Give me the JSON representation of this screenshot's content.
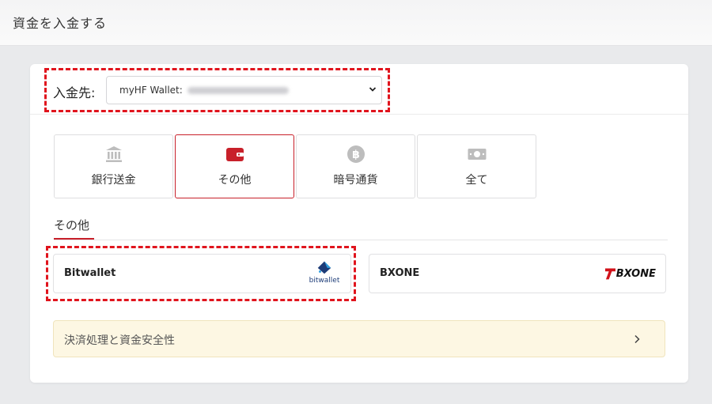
{
  "page": {
    "title": "資金を入金する"
  },
  "deposit_destination": {
    "label": "入金先:",
    "selected_value": "myHF Wallet:"
  },
  "tabs": [
    {
      "label": "銀行送金",
      "icon": "bank-icon",
      "active": false
    },
    {
      "label": "その他",
      "icon": "wallet-icon",
      "active": true
    },
    {
      "label": "暗号通貨",
      "icon": "bitcoin-icon",
      "active": false
    },
    {
      "label": "全て",
      "icon": "cash-icon",
      "active": false
    }
  ],
  "section": {
    "title": "その他"
  },
  "methods": [
    {
      "name": "Bitwallet",
      "logo_text": "bitwallet"
    },
    {
      "name": "BXONE",
      "logo_text": "BXONE"
    }
  ],
  "notice": {
    "text": "決済処理と資金安全性"
  },
  "colors": {
    "accent_red": "#c8202a",
    "highlight_red": "#e0141d",
    "icon_gray": "#bdbdbd",
    "notice_bg": "#fdf7e3",
    "bitwallet_blue": "#1d3c78"
  }
}
